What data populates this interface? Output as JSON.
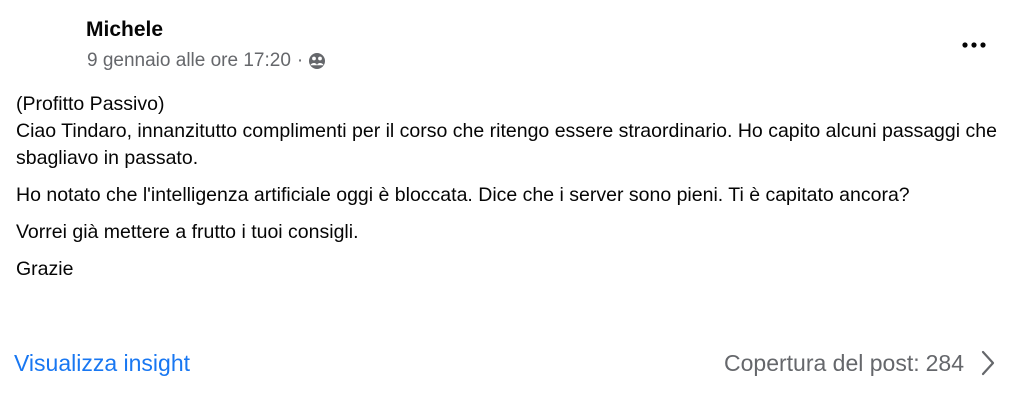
{
  "post": {
    "author": "Michele",
    "date": "9 gennaio alle ore 17:20",
    "meta_separator": "·",
    "audience_icon": "friends-audience-icon",
    "more_icon": "more-options-icon",
    "body": {
      "line1": "(Profitto Passivo)",
      "line2": "Ciao Tindaro, innanzitutto complimenti per il corso che ritengo essere straordinario. Ho capito alcuni passaggi che sbagliavo in passato.",
      "paragraph2": "Ho notato che l'intelligenza artificiale oggi è bloccata. Dice che i server sono pieni. Ti è capitato ancora?",
      "paragraph3": "Vorrei già mettere a frutto i tuoi consigli.",
      "paragraph4": "Grazie"
    }
  },
  "footer": {
    "insights_link": "Visualizza insight",
    "reach_label": "Copertura del post:",
    "reach_value": "284",
    "chevron_icon": "chevron-right-icon"
  },
  "colors": {
    "link": "#1877f2",
    "secondary_text": "#65676b",
    "primary_text": "#050505"
  }
}
